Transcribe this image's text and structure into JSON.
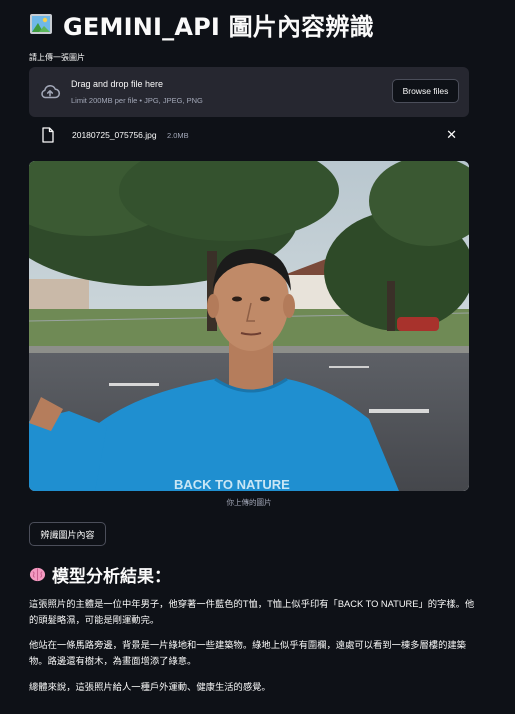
{
  "header": {
    "title": "GEMINI_API 圖片內容辨識",
    "icon": "picture-frame-icon"
  },
  "uploader": {
    "label": "請上傳一張圖片",
    "drop_text": "Drag and drop file here",
    "limit_text": "Limit 200MB per file • JPG, JPEG, PNG",
    "browse_label": "Browse files",
    "cloud_icon": "cloud-upload-icon"
  },
  "file": {
    "name": "20180725_075756.jpg",
    "size": "2.0MB",
    "icon": "file-icon",
    "remove_icon": "close-icon"
  },
  "image": {
    "caption": "你上傳的圖片",
    "shirt_text": "BACK TO NATURE"
  },
  "actions": {
    "analyze_label": "辨識圖片內容"
  },
  "result": {
    "icon": "brain-icon",
    "title": "模型分析結果：",
    "paragraphs": [
      "這張照片的主體是一位中年男子，他穿著一件藍色的T恤，T恤上似乎印有「BACK TO NATURE」的字樣。他的頭髮略濕，可能是剛運動完。",
      "他站在一條馬路旁邊，背景是一片綠地和一些建築物。綠地上似乎有圍欄，遠處可以看到一棟多層樓的建築物。路邊還有樹木，為畫面增添了綠意。",
      "總體來說，這張照片給人一種戶外運動、健康生活的感覺。"
    ]
  },
  "colors": {
    "background": "#0e1117",
    "dropzone": "#262730",
    "text": "#fafafa",
    "muted": "#a3a8b8",
    "shirt": "#1f8fd0"
  }
}
